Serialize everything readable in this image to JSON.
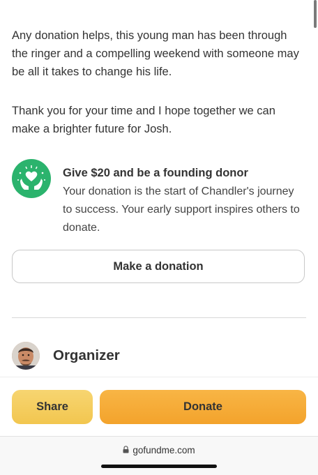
{
  "story": {
    "paragraph1": "Any donation helps, this young man has been through the ringer and a compelling weekend with someone may be all it takes to change his life.",
    "paragraph2": "Thank you for your time and I hope together we can make a brighter future for Josh."
  },
  "founding_donor": {
    "icon": "heart-hands-icon",
    "title": "Give $20 and be a founding donor",
    "description": "Your donation is the start of Chandler's journey to success. Your early support inspires others to donate."
  },
  "make_donation_label": "Make a donation",
  "organizer": {
    "label": "Organizer"
  },
  "actions": {
    "share_label": "Share",
    "donate_label": "Donate"
  },
  "browser": {
    "url": "gofundme.com"
  },
  "colors": {
    "badge_green": "#2bb36d",
    "share_yellow": "#f2c64f",
    "donate_orange": "#f3a32c"
  }
}
